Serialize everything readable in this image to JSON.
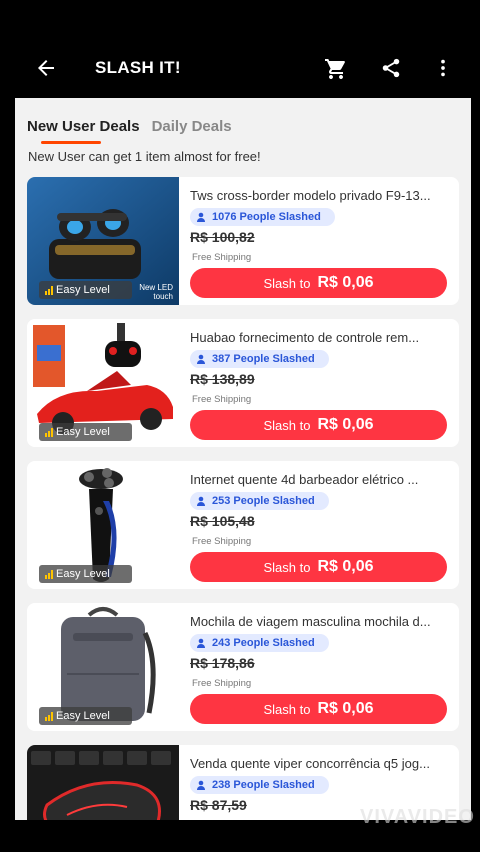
{
  "header": {
    "title": "SLASH IT!"
  },
  "tabs": [
    {
      "label": "New User Deals",
      "active": true
    },
    {
      "label": "Daily Deals",
      "active": false
    }
  ],
  "subtitle": "New User can get 1 item almost for free!",
  "products": [
    {
      "title": "Tws cross-border modelo privado F9-13...",
      "slashed": "1076 People Slashed",
      "old_price": "R$ 100,82",
      "shipping": "Free Shipping",
      "level": "Easy Level",
      "badge": "New LED touch",
      "button_label": "Slash to",
      "button_price": "R$ 0,06"
    },
    {
      "title": "Huabao fornecimento de controle rem...",
      "slashed": "387 People Slashed",
      "old_price": "R$ 138,89",
      "shipping": "Free Shipping",
      "level": "Easy Level",
      "button_label": "Slash to",
      "button_price": "R$ 0,06"
    },
    {
      "title": "Internet quente 4d barbeador elétrico ...",
      "slashed": "253 People Slashed",
      "old_price": "R$ 105,48",
      "shipping": "Free Shipping",
      "level": "Easy Level",
      "button_label": "Slash to",
      "button_price": "R$ 0,06"
    },
    {
      "title": "Mochila de viagem masculina mochila d...",
      "slashed": "243 People Slashed",
      "old_price": "R$ 178,86",
      "shipping": "Free Shipping",
      "level": "Easy Level",
      "button_label": "Slash to",
      "button_price": "R$ 0,06"
    },
    {
      "title": "Venda quente viper concorrência q5 jog...",
      "slashed": "238 People Slashed",
      "old_price": "R$ 87,59"
    }
  ],
  "watermark": "VIVAVIDEO",
  "colors": {
    "accent": "#fe3542",
    "tab_underline": "#ff4500",
    "slashed_text": "#2a56d8"
  }
}
